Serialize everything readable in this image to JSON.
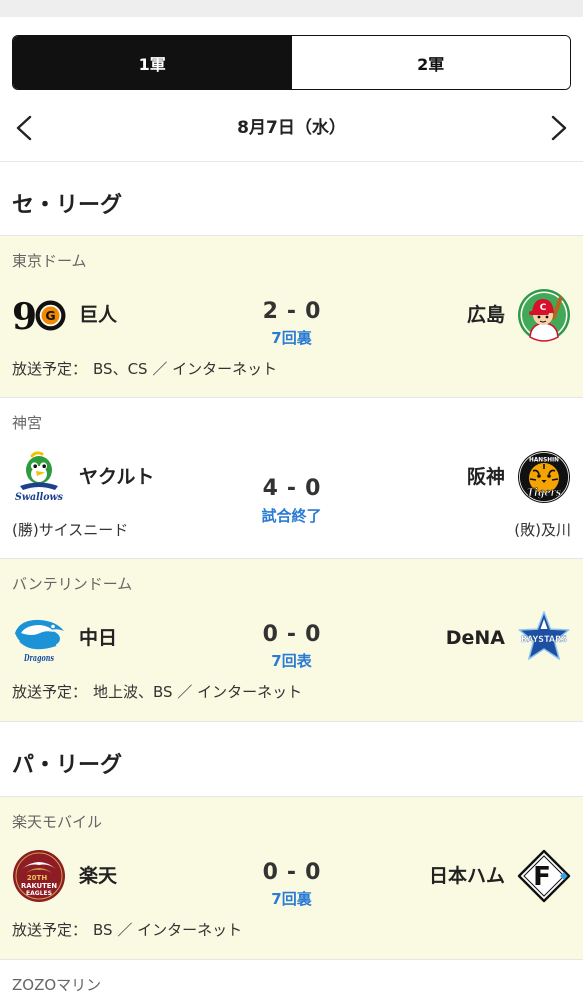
{
  "tabs": [
    {
      "label": "1軍",
      "active": true
    },
    {
      "label": "2軍",
      "active": false
    }
  ],
  "date_nav": {
    "date": "8月7日（水）",
    "prev_icon": "chevron-left-icon",
    "next_icon": "chevron-right-icon"
  },
  "score_separator": "-",
  "broadcast_label": "放送予定：",
  "leagues": [
    {
      "title": "セ・リーグ",
      "games": [
        {
          "venue": "東京ドーム",
          "home": {
            "name": "巨人",
            "score": "2",
            "logo": "giants-logo",
            "logo_text": [
              "9",
              "G"
            ]
          },
          "away": {
            "name": "広島",
            "score": "0",
            "logo": "carp-logo",
            "logo_text": [
              "C"
            ]
          },
          "status": "7回裏",
          "broadcast": "BS、CS ／ インターネット"
        },
        {
          "venue": "神宮",
          "home": {
            "name": "ヤクルト",
            "score": "4",
            "logo": "swallows-logo",
            "logo_text": [
              "Swallows"
            ]
          },
          "away": {
            "name": "阪神",
            "score": "0",
            "logo": "tigers-logo",
            "logo_text": [
              "HANSHIN",
              "Tigers"
            ]
          },
          "status": "試合終了",
          "winning_pitcher": "(勝)サイスニード",
          "losing_pitcher": "(敗)及川"
        },
        {
          "venue": "バンテリンドーム",
          "home": {
            "name": "中日",
            "score": "0",
            "logo": "dragons-logo",
            "logo_text": [
              "Dragons"
            ]
          },
          "away": {
            "name": "DeNA",
            "score": "0",
            "logo": "baystars-logo",
            "logo_text": [
              "BAYSTARS"
            ]
          },
          "status": "7回表",
          "broadcast": "地上波、BS ／ インターネット"
        }
      ]
    },
    {
      "title": "パ・リーグ",
      "games": [
        {
          "venue": "楽天モバイル",
          "home": {
            "name": "楽天",
            "score": "0",
            "logo": "eagles-logo",
            "logo_text": [
              "20TH",
              "RAKUTEN",
              "EAGLES"
            ]
          },
          "away": {
            "name": "日本ハム",
            "score": "0",
            "logo": "fighters-logo",
            "logo_text": [
              "F"
            ]
          },
          "status": "7回裏",
          "broadcast": "BS ／ インターネット"
        },
        {
          "venue": "ZOZOマリン"
        }
      ]
    }
  ],
  "colors": {
    "tab_active_bg": "#111111",
    "status_blue": "#2a7bd4",
    "live_card_bg": "#fafae3",
    "venue_gray": "#666666",
    "divider": "#e6e6e6"
  }
}
